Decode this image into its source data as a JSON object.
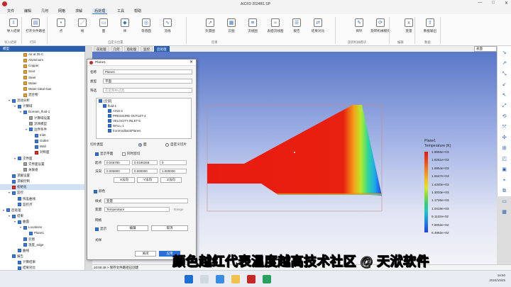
{
  "app": {
    "title": "AICFD 2024R1 SP"
  },
  "menu": [
    "文件",
    "编辑",
    "几何",
    "网格",
    "求解",
    "后处理",
    "工具",
    "帮助"
  ],
  "menu_selected": "后处理",
  "ribbon": {
    "buttons": [
      {
        "label": "导入结果",
        "icon": "import-icon"
      },
      {
        "label": "打开文件路径",
        "icon": "folder-icon"
      },
      {
        "label": "点",
        "icon": "point-icon"
      },
      {
        "label": "线",
        "icon": "line-icon"
      },
      {
        "label": "面",
        "icon": "plane-icon"
      },
      {
        "label": "体",
        "icon": "volume-icon"
      },
      {
        "label": "等值面",
        "icon": "isosurface-icon"
      },
      {
        "label": "流线",
        "icon": "streamline-icon"
      },
      {
        "label": "矢量图",
        "icon": "vector-icon"
      },
      {
        "label": "云图",
        "icon": "contour-icon"
      },
      {
        "label": "流线图",
        "icon": "streamline-plot-icon"
      },
      {
        "label": "表面流线图",
        "icon": "surface-streamline-icon"
      },
      {
        "label": "报告",
        "icon": "report-icon"
      },
      {
        "label": "结果对比",
        "icon": "compare-icon"
      },
      {
        "label": "探针",
        "icon": "probe-icon"
      },
      {
        "label": "旋转机械模块",
        "icon": "rotating-icon"
      },
      {
        "label": "变量",
        "icon": "variable-icon"
      },
      {
        "label": "数据输出",
        "icon": "export-icon"
      }
    ],
    "groups": [
      "导入结果",
      "打开",
      "自定义位置",
      "",
      "结果",
      "",
      "旋转机械模块",
      "",
      "编辑",
      "数据"
    ]
  },
  "tree": {
    "header": "模型",
    "items": [
      {
        "label": "Air at 25 C",
        "level": 3,
        "icon": "o"
      },
      {
        "label": "Aluminium",
        "level": 3,
        "icon": "o"
      },
      {
        "label": "Copper",
        "level": 3,
        "icon": "o"
      },
      {
        "label": "Soot",
        "level": 3,
        "icon": "o"
      },
      {
        "label": "Steel",
        "level": 3,
        "icon": "o"
      },
      {
        "label": "Water",
        "level": 3,
        "icon": "o"
      },
      {
        "label": "Water Ideal Gas",
        "level": 3,
        "icon": "o"
      },
      {
        "label": "混合物",
        "level": 3,
        "icon": "o"
      },
      {
        "label": "流动分析",
        "level": 1,
        "icon": "b",
        "twisty": "▾"
      },
      {
        "label": "计算域",
        "level": 2,
        "icon": "b",
        "twisty": "▾"
      },
      {
        "label": "Domain_fluid-1",
        "level": 3,
        "icon": "b",
        "twisty": "▾"
      },
      {
        "label": "计算域设置",
        "level": 4,
        "icon": "gray"
      },
      {
        "label": "流体模型",
        "level": 4,
        "icon": "gray"
      },
      {
        "label": "边界条件",
        "level": 4,
        "icon": "b",
        "twisty": "▾"
      },
      {
        "label": "Inlet",
        "level": 5,
        "icon": "b"
      },
      {
        "label": "Outlet",
        "level": 5,
        "icon": "b"
      },
      {
        "label": "Wall",
        "level": 5,
        "icon": "b"
      },
      {
        "label": "对称面",
        "level": 5,
        "icon": "r"
      },
      {
        "label": "交界面",
        "level": 2,
        "icon": "b",
        "twisty": "▾"
      },
      {
        "label": "交界面设置",
        "level": 3,
        "icon": "gray"
      },
      {
        "label": "关联组",
        "level": 3,
        "icon": "gray"
      },
      {
        "label": "求解设置",
        "level": 1,
        "icon": "b"
      },
      {
        "label": "求解控制",
        "level": 1,
        "icon": "b"
      },
      {
        "label": "初始化",
        "level": 1,
        "icon": "r",
        "selected": true
      },
      {
        "label": "监控",
        "level": 1,
        "icon": "b",
        "twisty": "▾"
      },
      {
        "label": "残差曲线",
        "level": 2,
        "icon": "b"
      },
      {
        "label": "监控点",
        "level": 2,
        "icon": "b"
      },
      {
        "label": "后处理",
        "level": 0,
        "icon": "b",
        "twisty": "▾"
      },
      {
        "label": "结果",
        "level": 1,
        "icon": "b",
        "twisty": "▾"
      },
      {
        "label": "曲面",
        "level": 2,
        "icon": "b",
        "twisty": "▾"
      },
      {
        "label": "Locations",
        "level": 3,
        "icon": "b",
        "twisty": "▾"
      },
      {
        "label": "Plane1",
        "level": 4,
        "icon": "b"
      },
      {
        "label": "云图",
        "level": 3,
        "icon": "b"
      },
      {
        "label": "温度_edge",
        "level": 3,
        "icon": "b"
      },
      {
        "label": "曲线",
        "level": 2,
        "icon": "b"
      },
      {
        "label": "报告",
        "level": 1,
        "icon": "b"
      },
      {
        "label": "计算结果",
        "level": 2,
        "icon": "b"
      },
      {
        "label": "结果对比",
        "level": 2,
        "icon": "b"
      }
    ]
  },
  "tabs": [
    {
      "label": "前处理",
      "active": false
    },
    {
      "label": "几何",
      "active": false
    },
    {
      "label": "后处理",
      "active": false
    },
    {
      "label": "监控",
      "active": false
    },
    {
      "label": "后处理",
      "active": true
    }
  ],
  "view_select": "表面",
  "dialog": {
    "title": "Plane1",
    "name_label": "名称",
    "name_value": "Plane1",
    "type_label": "类型",
    "type_value": "平面",
    "filter_label": "筛选",
    "filter_placeholder": "在名称中过滤",
    "selection_items": [
      "[全部]",
      "fluid-1",
      "AXIS-2",
      "PRESSURE-OUTLET-4",
      "VELOCITY-INLET-5",
      "WALL-1",
      "frontAndbackPlanes"
    ],
    "plane_type_label": "切片类型",
    "plane_type_option1": "面",
    "plane_type_option2": "自定义切片",
    "show_plane_label": "显示平面",
    "clip_label": "同时剪切",
    "origin_label": "起点",
    "origin_values": [
      "0.046795",
      "0.0196268",
      "0"
    ],
    "normal_label": "法向",
    "normal_values": [
      "0.000000",
      "0.000000",
      "1.000000"
    ],
    "axis_buttons": [
      "X法向",
      "Y法向",
      "Z法向"
    ],
    "color_label": "颜色",
    "style_label": "样式",
    "style_value": "变量",
    "variable_label": "变量",
    "variable_value": "Temperature",
    "range_label": "Range",
    "mesh_label": "网格",
    "display_label": "显示",
    "edit_label": "编辑",
    "cancel_label": "取消",
    "style2_label": "式样",
    "close_button": "关闭",
    "apply_button": "应用"
  },
  "legend": {
    "title": "Plane1",
    "subtitle": "Temperature (K)",
    "values": [
      "1.9966e+03",
      "1.8261e+03",
      "1.6954e+03",
      "1.5647e+03",
      "1.4340e+03",
      "1.3033e+03",
      "1.1726e+03",
      "1.0419e+03",
      "9.1122e+02",
      "7.8052e+02",
      "6.4982e+02"
    ]
  },
  "status": "10:00:48 > 保存文件路径已创建",
  "clock": {
    "time": "16:50",
    "date": "2024/10/25"
  },
  "subtitle": "颜色越红代表温度越高",
  "watermark": "技术社区 @ 天洑软件"
}
